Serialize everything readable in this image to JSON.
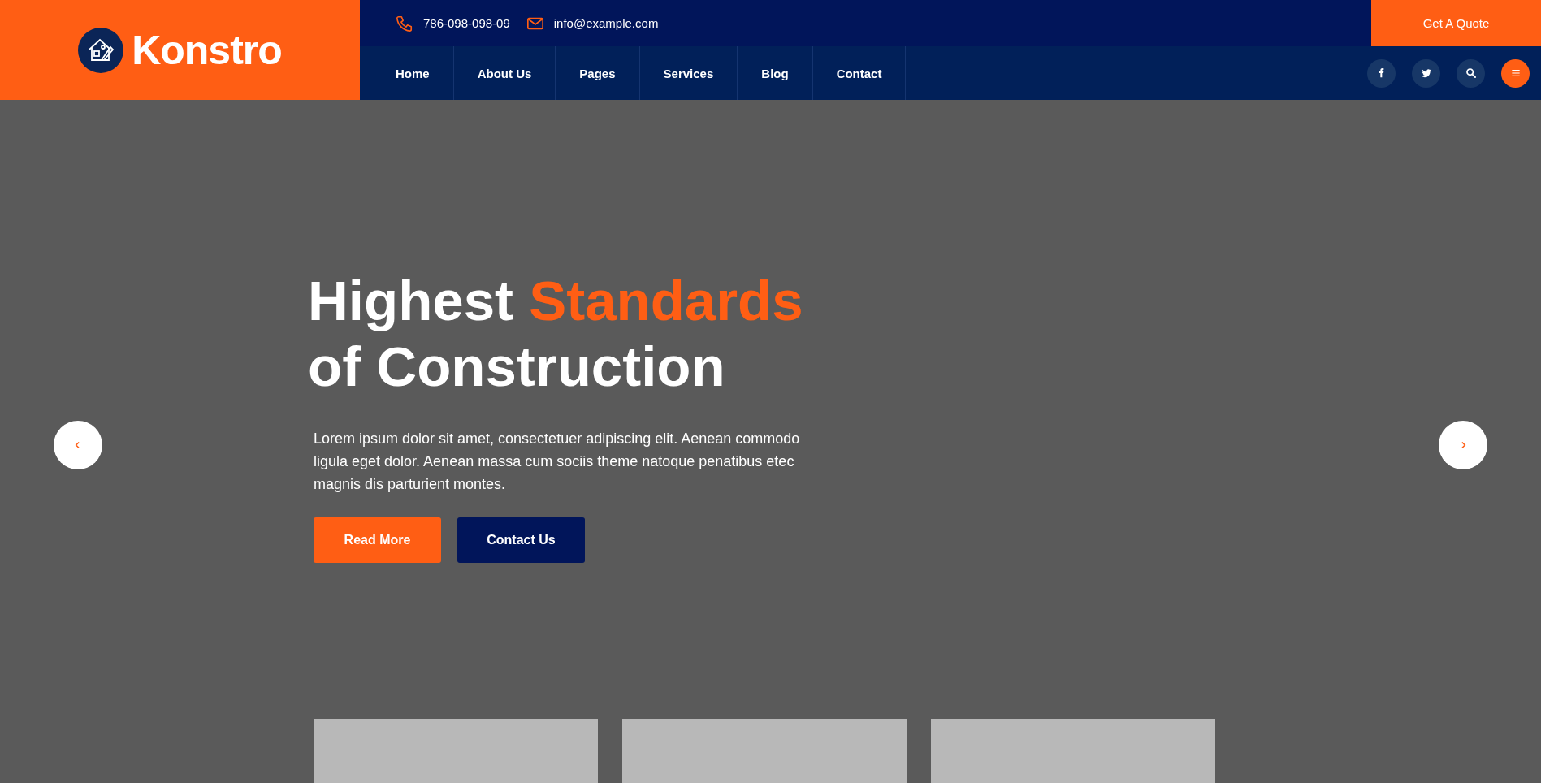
{
  "header": {
    "logo": {
      "text": "Konstro"
    },
    "contacts": [
      {
        "kind": "phone",
        "text": "786-098-098-09"
      },
      {
        "kind": "email",
        "text": "info@example.com"
      }
    ],
    "quote_button": "Get A Quote",
    "nav": [
      {
        "label": "Home"
      },
      {
        "label": "About Us"
      },
      {
        "label": "Pages"
      },
      {
        "label": "Services"
      },
      {
        "label": "Blog"
      },
      {
        "label": "Contact"
      }
    ],
    "actions": [
      {
        "kind": "facebook",
        "highlight": false
      },
      {
        "kind": "twitter",
        "highlight": false
      },
      {
        "kind": "search",
        "highlight": false
      },
      {
        "kind": "menu",
        "highlight": true
      }
    ]
  },
  "hero": {
    "title_lines": [
      [
        {
          "text": "Highest ",
          "accent": false
        },
        {
          "text": "Standards",
          "accent": true
        }
      ],
      [
        {
          "text": "of Construction",
          "accent": false
        }
      ]
    ],
    "text": "Lorem ipsum dolor sit amet, consectetuer adipiscing elit. Aenean commodo ligula eget dolor. Aenean massa cum sociis theme natoque penatibus etec magnis dis parturient montes.",
    "buttons": [
      {
        "label": "Read More",
        "kind": "primary"
      },
      {
        "label": "Contact Us",
        "kind": "secondary"
      }
    ],
    "arrows": [
      {
        "kind": "prev"
      },
      {
        "kind": "next"
      }
    ]
  },
  "cards": [
    {
      "kind": "placeholder"
    },
    {
      "kind": "placeholder"
    },
    {
      "kind": "placeholder"
    }
  ]
}
